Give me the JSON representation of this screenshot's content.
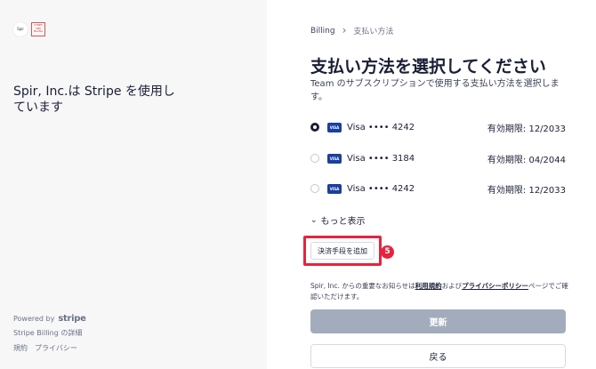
{
  "left": {
    "logo_text": "Spir",
    "stamp_text": "STRIPE SPIR BILLING",
    "merchant_statement": "Spir, Inc.は Stripe を使用しています",
    "powered_by": "Powered by",
    "stripe_word": "stripe",
    "billing_details": "Stripe Billing の詳細",
    "terms": "規約",
    "privacy": "プライバシー"
  },
  "breadcrumb": {
    "billing": "Billing",
    "separator": "›",
    "current": "支払い方法"
  },
  "page_title": "支払い方法を選択してください",
  "subtitle": "Team のサブスクリプションで使用する支払い方法を選択します。",
  "payment_methods": [
    {
      "brand": "VISA",
      "label": "Visa •••• 4242",
      "expiry": "有効期限: 12/2033",
      "selected": true
    },
    {
      "brand": "VISA",
      "label": "Visa •••• 3184",
      "expiry": "有効期限: 04/2044",
      "selected": false
    },
    {
      "brand": "VISA",
      "label": "Visa •••• 4242",
      "expiry": "有効期限: 12/2033",
      "selected": false
    }
  ],
  "show_more": "もっと表示",
  "add_payment_method": "決済手段を追加",
  "step_badge": "5",
  "notice": {
    "prefix": "Spir, Inc. からの重要なお知らせは",
    "terms_link": "利用規約",
    "middle": "および",
    "privacy_link": "プライバシーポリシー",
    "suffix": "ページでご確認いただけます。"
  },
  "update_button": "更新",
  "back_button": "戻る",
  "colors": {
    "highlight": "#e8233c",
    "visa_blue": "#1a3fa0",
    "disabled_button": "#a3acbd"
  }
}
